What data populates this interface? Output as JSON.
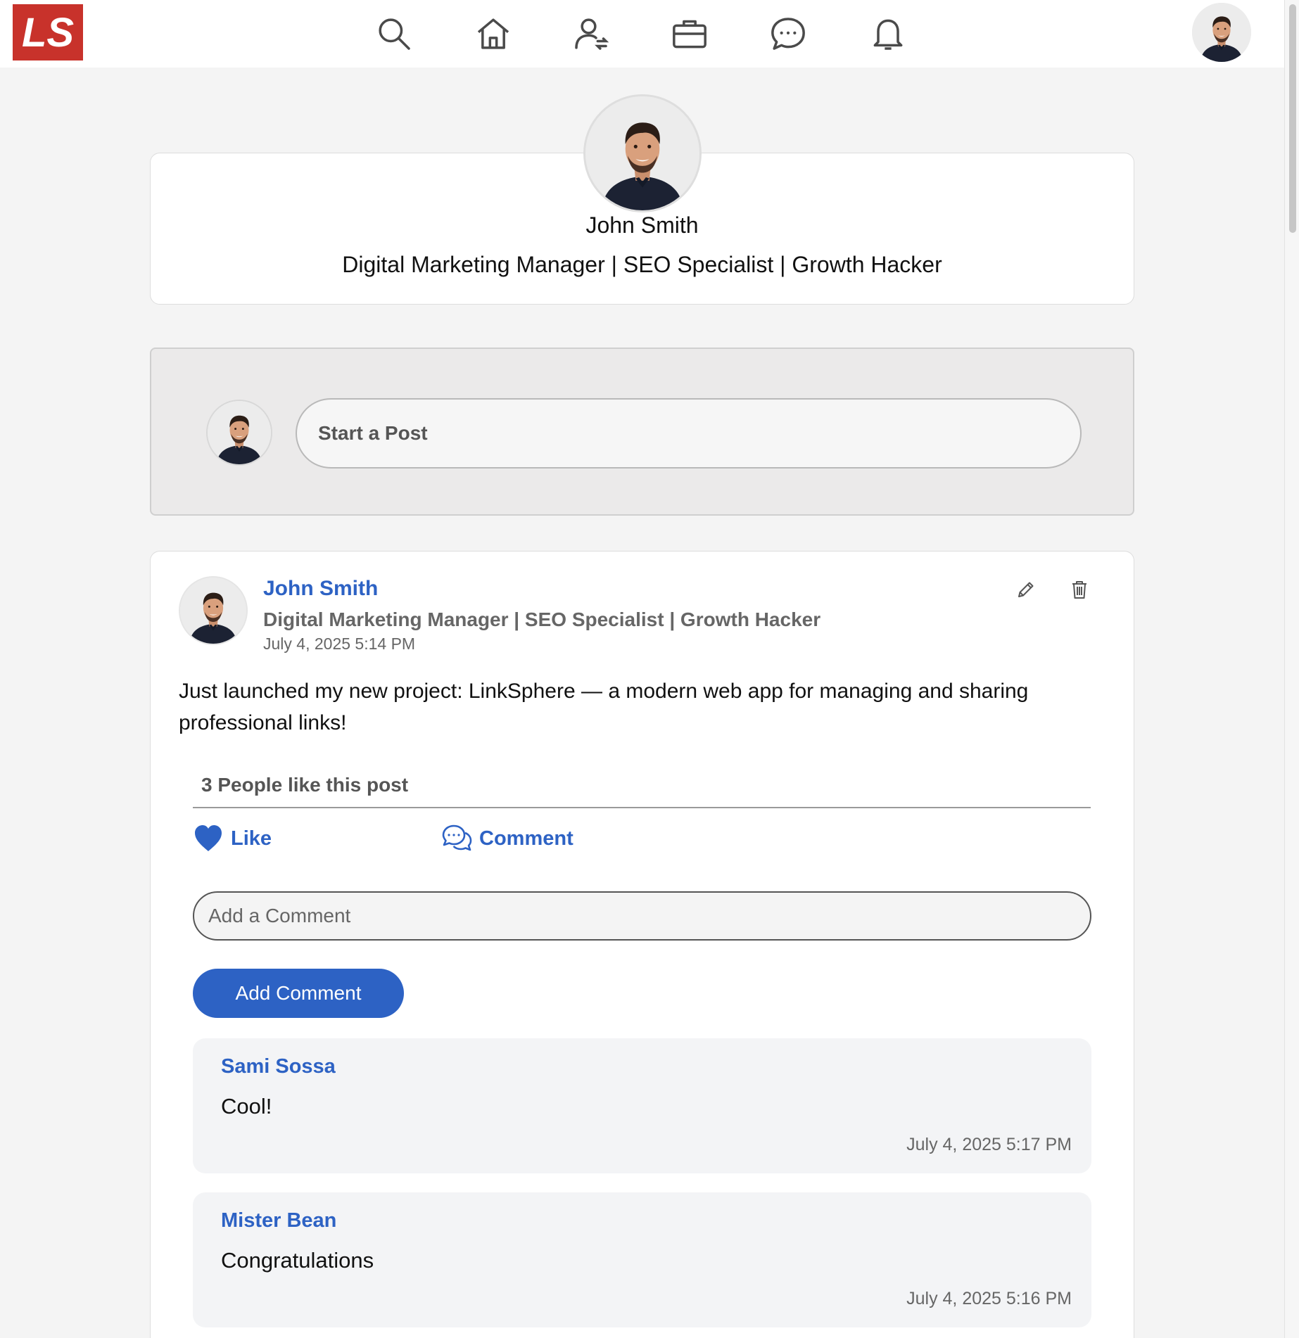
{
  "logo": {
    "text": "LS",
    "color": "#c8322b"
  },
  "nav": {
    "icons": [
      "search-icon",
      "home-icon",
      "network-icon",
      "jobs-icon",
      "messaging-icon",
      "notifications-icon"
    ]
  },
  "profile": {
    "name": "John Smith",
    "headline": "Digital Marketing Manager | SEO Specialist | Growth Hacker"
  },
  "composer": {
    "start_post_label": "Start a Post"
  },
  "post": {
    "author": "John Smith",
    "headline": "Digital Marketing Manager | SEO Specialist | Growth Hacker",
    "timestamp": "July 4, 2025 5:14 PM",
    "text": "Just launched my new project: LinkSphere — a modern web app for managing and sharing professional links!",
    "likes_text": "3 People like this post",
    "like_label": "Like",
    "comment_label": "Comment",
    "comment_placeholder": "Add a Comment",
    "add_comment_label": "Add Comment",
    "comments": [
      {
        "author": "Sami Sossa",
        "text": "Cool!",
        "timestamp": "July 4, 2025 5:17 PM"
      },
      {
        "author": "Mister Bean",
        "text": "Congratulations",
        "timestamp": "July 4, 2025 5:16 PM"
      }
    ]
  },
  "colors": {
    "accent": "#2d62c4",
    "brand": "#c8322b",
    "background": "#f4f4f4"
  }
}
